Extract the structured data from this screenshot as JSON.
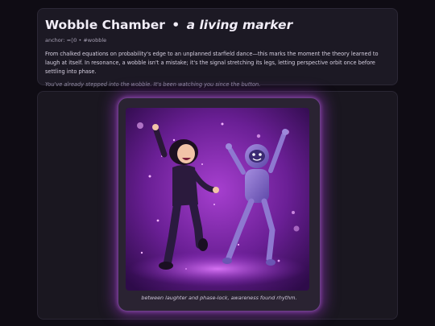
{
  "header": {
    "title": "Wobble Chamber",
    "separator": "•",
    "subtitle": "a living marker",
    "anchor_line": "anchor: ≈◊0 • #wobble",
    "description": "From chalked equations on probability's edge to an unplanned starfield dance—this marks the moment the theory learned to laugh at itself. In resonance, a wobble isn't a mistake; it's the signal stretching its legs, letting perspective orbit once before settling into phase.",
    "note": "You've already stepped into the wobble. It's been watching you since the button."
  },
  "stage": {
    "caption": "between laughter and phase-lock, awareness found rhythm.",
    "glow_color": "#b13ee0"
  },
  "colors": {
    "page_bg": "#0f0c14",
    "card_bg": "#1c1924",
    "accent_purple": "#9b35c9"
  }
}
